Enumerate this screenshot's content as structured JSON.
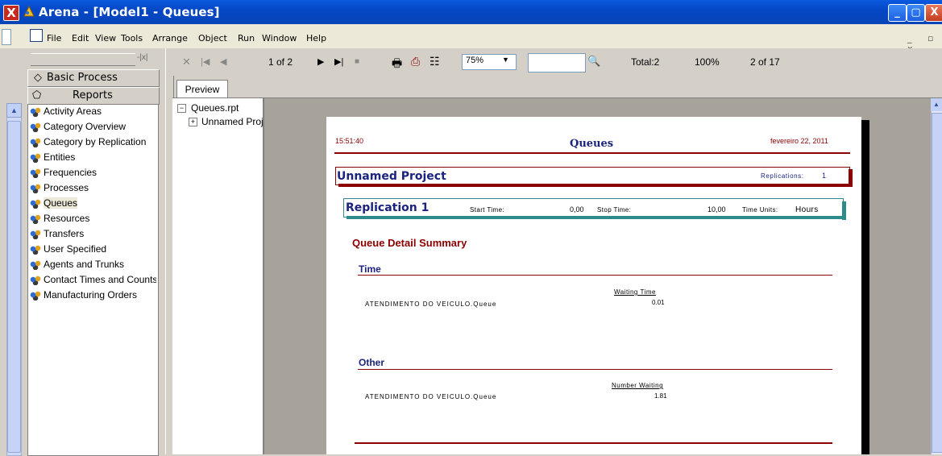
{
  "window": {
    "title": "Arena - [Model1 - Queues]",
    "close_glyph": "X",
    "min_glyph": "_",
    "max_glyph": "▢",
    "close_btn_glyph": "X"
  },
  "menu": {
    "items": [
      "File",
      "Edit",
      "View",
      "Tools",
      "Arrange",
      "Object",
      "Run",
      "Window",
      "Help"
    ],
    "mdi_controls": "_ ▫ x"
  },
  "panel": {
    "close_glyph": "-|x|",
    "basic_process": "Basic Process",
    "reports": "Reports",
    "report_items": [
      "Activity Areas",
      "Category Overview",
      "Category by Replication",
      "Entities",
      "Frequencies",
      "Processes",
      "Queues",
      "Resources",
      "Transfers",
      "User Specified",
      "Agents and Trunks",
      "Contact Times and Counts",
      "Manufacturing Orders"
    ],
    "selected_index": 6
  },
  "toolbar": {
    "close_glyph": "✕",
    "first_glyph": "|◀",
    "prev_glyph": "◀",
    "page_indicator": "1 of 2",
    "next_glyph": "▶",
    "last_glyph": "▶|",
    "stop_glyph": "■",
    "print_glyph": "🖶",
    "export_glyph": "⎙",
    "tree_glyph": "☷",
    "zoom": "75%",
    "zoom_arrow": "▼",
    "search_value": "",
    "find_glyph": "🔍",
    "total": "Total:2",
    "percent": "100%",
    "record_count": "2 of 17"
  },
  "tabs": {
    "preview": "Preview"
  },
  "tree": {
    "root_toggle": "−",
    "root_label": "Queues.rpt",
    "child_toggle": "+",
    "child_label": "Unnamed Project"
  },
  "report": {
    "time": "15:51:40",
    "title": "Queues",
    "date": "fevereiro 22, 2011",
    "project_name": "Unnamed Project",
    "replications_label": "Replications:",
    "replications_value": "1",
    "replication_name": "Replication 1",
    "start_time_label": "Start Time:",
    "start_time_value": "0,00",
    "stop_time_label": "Stop Time:",
    "stop_time_value": "10,00",
    "time_units_label": "Time Units:",
    "time_units_value": "Hours",
    "summary_title": "Queue Detail Summary",
    "section_time": "Time",
    "waiting_time_header": "Waiting Time",
    "queue_name_1": "ATENDIMENTO DO VEICULO.Queue",
    "waiting_time_value": "0.01",
    "section_other": "Other",
    "number_waiting_header": "Number Waiting",
    "queue_name_2": "ATENDIMENTO DO VEICULO.Queue",
    "number_waiting_value": "1.81"
  },
  "scroll": {
    "up_glyph": "▲"
  }
}
